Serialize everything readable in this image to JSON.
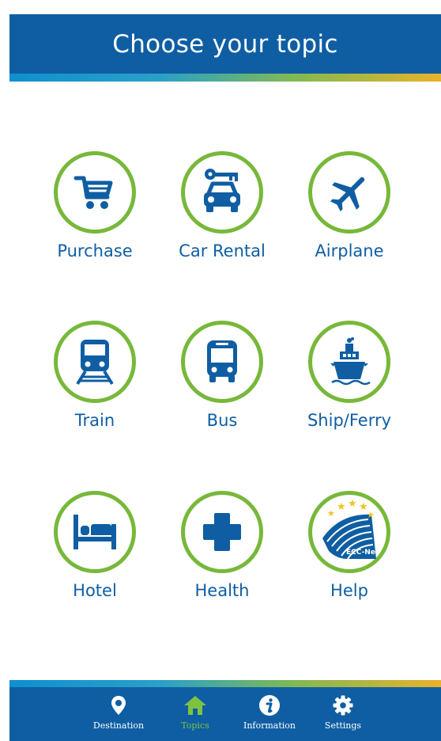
{
  "header": {
    "title": "Choose your topic"
  },
  "topics": [
    {
      "label": "Purchase",
      "icon": "shopping-cart-icon"
    },
    {
      "label": "Car Rental",
      "icon": "car-key-icon"
    },
    {
      "label": "Airplane",
      "icon": "airplane-icon"
    },
    {
      "label": "Train",
      "icon": "train-icon"
    },
    {
      "label": "Bus",
      "icon": "bus-icon"
    },
    {
      "label": "Ship/Ferry",
      "icon": "ship-icon"
    },
    {
      "label": "Hotel",
      "icon": "bed-icon"
    },
    {
      "label": "Health",
      "icon": "medical-cross-icon"
    },
    {
      "label": "Help",
      "icon": "ecc-net-logo-icon",
      "logo_text": "ECC-Net"
    }
  ],
  "tabbar": {
    "items": [
      {
        "label": "Destination",
        "icon": "map-pin-icon",
        "active": false
      },
      {
        "label": "Topics",
        "icon": "home-icon",
        "active": true
      },
      {
        "label": "Information",
        "icon": "info-icon",
        "active": false
      },
      {
        "label": "Settings",
        "icon": "gear-icon",
        "active": false
      }
    ]
  },
  "colors": {
    "primary_blue": "#0f5ea3",
    "circle_green": "#77b83a",
    "active_tab_green": "#7fc241",
    "background": "#ffffff"
  }
}
